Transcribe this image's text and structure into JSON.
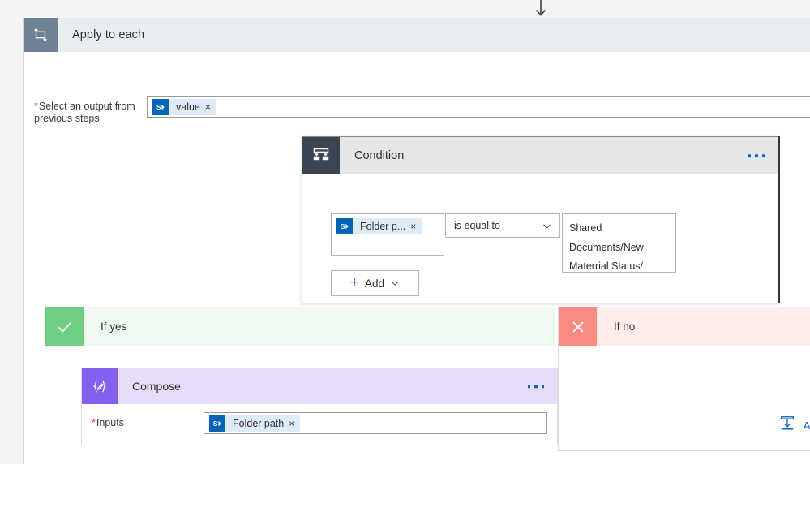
{
  "connector": {
    "icon": "arrow-down-icon"
  },
  "apply_to_each": {
    "icon": "loop-repeat-icon",
    "title": "Apply to each",
    "field": {
      "label": "Select an output from previous steps",
      "required_marker": "*",
      "token": {
        "icon": "sharepoint-icon",
        "label": "value",
        "remove": "×"
      }
    }
  },
  "condition": {
    "icon": "condition-branch-icon",
    "title": "Condition",
    "menu": "more-options",
    "operand": {
      "token": {
        "icon": "sharepoint-icon",
        "label": "Folder p...",
        "remove": "×"
      }
    },
    "operator": {
      "value": "is equal to",
      "chevron": "chevron-down-icon"
    },
    "value": "Shared Documents/New Materrial Status/",
    "add_button": {
      "plus": "+",
      "label": "Add",
      "chevron": "chevron-down-icon"
    }
  },
  "branch_yes": {
    "badge_icon": "checkmark-icon",
    "title": "If yes",
    "compose": {
      "icon": "compose-braces-pencil-icon",
      "title": "Compose",
      "menu": "more-options",
      "inputs_label": "Inputs",
      "required_marker": "*",
      "token": {
        "icon": "sharepoint-icon",
        "label": "Folder path",
        "remove": "×"
      }
    }
  },
  "branch_no": {
    "badge_icon": "close-x-icon",
    "title": "If no",
    "add_action": {
      "icon": "add-step-icon",
      "label": "Add an"
    }
  },
  "colors": {
    "apply_icon_bg": "#718195",
    "apply_header_bg": "#eaedf0",
    "condition_icon_bg": "#3b4552",
    "condition_header_bg": "#e4e6e8",
    "yes_badge": "#6ece83",
    "yes_header": "#eefaf0",
    "no_badge": "#f98b80",
    "no_header": "#fdeeec",
    "compose_icon_bg": "#8661f0",
    "compose_header_bg": "#e6ddfb",
    "sharepoint_blue": "#0364b8",
    "token_bg": "#deecf9",
    "accent_link": "#1967c0",
    "required_red": "#d13438",
    "plus_purple": "#8b5cf6"
  }
}
